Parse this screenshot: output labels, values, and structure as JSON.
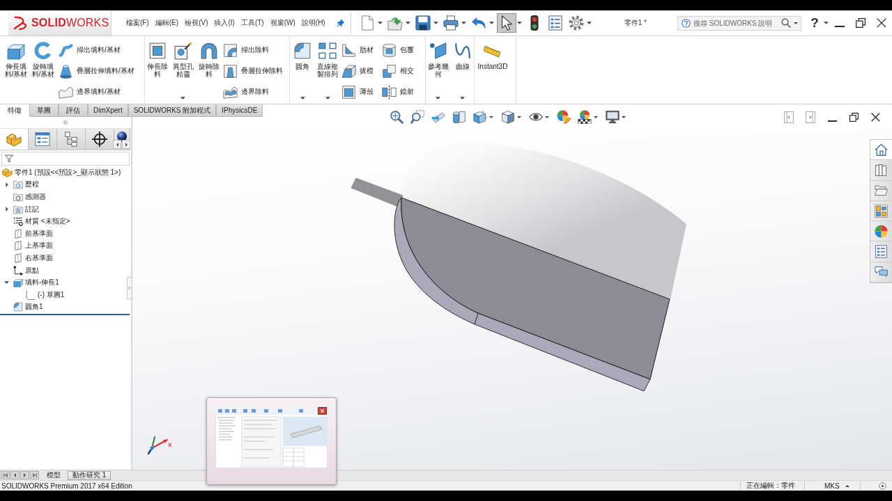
{
  "title_bar": {
    "logo": "**SOLID**WORKS",
    "menus": [
      "檔案(F)",
      "編輯(E)",
      "檢視(V)",
      "插入(I)",
      "工具(T)",
      "視窗(W)",
      "說明(H)"
    ],
    "quick_access": [
      {
        "pressed": false,
        "dropdown": true
      },
      {
        "pressed": false,
        "dropdown": true
      },
      {
        "pressed": false,
        "dropdown": true
      },
      {
        "pressed": false,
        "dropdown": true
      },
      {
        "pressed": false,
        "dropdown": true
      },
      {
        "pressed": true,
        "dropdown": true
      },
      {
        "pressed": false,
        "dropdown": false
      },
      {
        "pressed": false,
        "dropdown": false
      },
      {
        "pressed": false,
        "dropdown": true
      }
    ],
    "document_title": "零件1 *",
    "search": {
      "placeholder": "搜尋 SOLIDWORKS 說明"
    },
    "help_label": "?"
  },
  "ribbon": {
    "groups": [
      {
        "items": [
          {
            "kind": "large",
            "label": "伸長填料/基材",
            "dropdown": false
          },
          {
            "kind": "large",
            "label": "旋轉填料/基材",
            "dropdown": false
          },
          {
            "kind": "stack",
            "buttons": [
              "掃出填料/基材",
              "疊層拉伸填料/基材",
              "邊界填料/基材"
            ]
          }
        ]
      },
      {
        "items": [
          {
            "kind": "large",
            "label": "伸長除料",
            "dropdown": false
          },
          {
            "kind": "large",
            "label": "異型孔精靈",
            "dropdown": true
          },
          {
            "kind": "large",
            "label": "旋轉除料",
            "dropdown": false
          },
          {
            "kind": "stack",
            "buttons": [
              "掃出除料",
              "疊層拉伸除料",
              "邊界除料"
            ]
          }
        ]
      },
      {
        "items": [
          {
            "kind": "large",
            "label": "圓角",
            "dropdown": true
          },
          {
            "kind": "large",
            "label": "直線複製排列",
            "dropdown": true
          },
          {
            "kind": "stack",
            "buttons": [
              "肋材",
              "拔模",
              "薄殼"
            ]
          },
          {
            "kind": "stack",
            "buttons": [
              "包覆",
              "相交",
              "鏡射"
            ]
          }
        ]
      },
      {
        "items": [
          {
            "kind": "large",
            "label": "參考幾何",
            "dropdown": true
          },
          {
            "kind": "large",
            "label": "曲線",
            "dropdown": true
          }
        ]
      },
      {
        "items": [
          {
            "kind": "large",
            "label": "Instant3D",
            "dropdown": false
          }
        ]
      }
    ]
  },
  "command_tabs": [
    {
      "label": "特徵",
      "selected": true
    },
    {
      "label": "草圖",
      "selected": false
    },
    {
      "label": "評估",
      "selected": false
    },
    {
      "label": "DimXpert",
      "selected": false
    },
    {
      "label": "SOLIDWORKS 附加程式",
      "selected": false
    },
    {
      "label": "IPhysicsDE",
      "selected": false
    }
  ],
  "feature_manager": {
    "panel_tabs": [
      {
        "selected": true
      },
      {
        "selected": false
      },
      {
        "selected": false
      },
      {
        "selected": false
      },
      {
        "selected": false
      }
    ],
    "tree": [
      {
        "label": "零件1 (預設<<預設>_顯示狀態 1>)",
        "kind": "part",
        "children": [
          {
            "label": "歷程",
            "kind": "history",
            "expanded": false
          },
          {
            "label": "感測器",
            "kind": "sensors"
          },
          {
            "label": "註記",
            "kind": "annotations",
            "expanded": false
          },
          {
            "label": "材質 <未指定>",
            "kind": "material"
          },
          {
            "label": "前基準面",
            "kind": "plane"
          },
          {
            "label": "上基準面",
            "kind": "plane"
          },
          {
            "label": "右基準面",
            "kind": "plane"
          },
          {
            "label": "原點",
            "kind": "origin"
          },
          {
            "label": "填料-伸長1",
            "kind": "extrude",
            "expanded": true,
            "children": [
              {
                "label": "(-) 草圖1",
                "kind": "sketch"
              }
            ]
          },
          {
            "label": "圓角1",
            "kind": "fillet"
          }
        ]
      }
    ]
  },
  "view_toolbar": [
    {
      "dropdown": false
    },
    {
      "dropdown": false
    },
    {
      "dropdown": false
    },
    {
      "dropdown": false
    },
    {
      "dropdown": true
    },
    {
      "dropdown": true
    },
    {
      "dropdown": true
    },
    {
      "dropdown": false
    },
    {
      "dropdown": true
    },
    {
      "dropdown": true
    }
  ],
  "graphics": {
    "triad_label": "X"
  },
  "task_pane": [
    {
      "selected": true
    },
    {
      "selected": false
    },
    {
      "selected": false
    },
    {
      "selected": false
    },
    {
      "selected": false
    },
    {
      "selected": false
    },
    {
      "selected": false
    }
  ],
  "bottom_tabs": [
    {
      "label": "模型",
      "selected": true
    },
    {
      "label": "動作研究 1",
      "selected": false
    }
  ],
  "status_bar": {
    "product": "SOLIDWORKS Premium 2017 x64 Edition",
    "mode": "正在編輯：零件",
    "units": "MKS"
  }
}
